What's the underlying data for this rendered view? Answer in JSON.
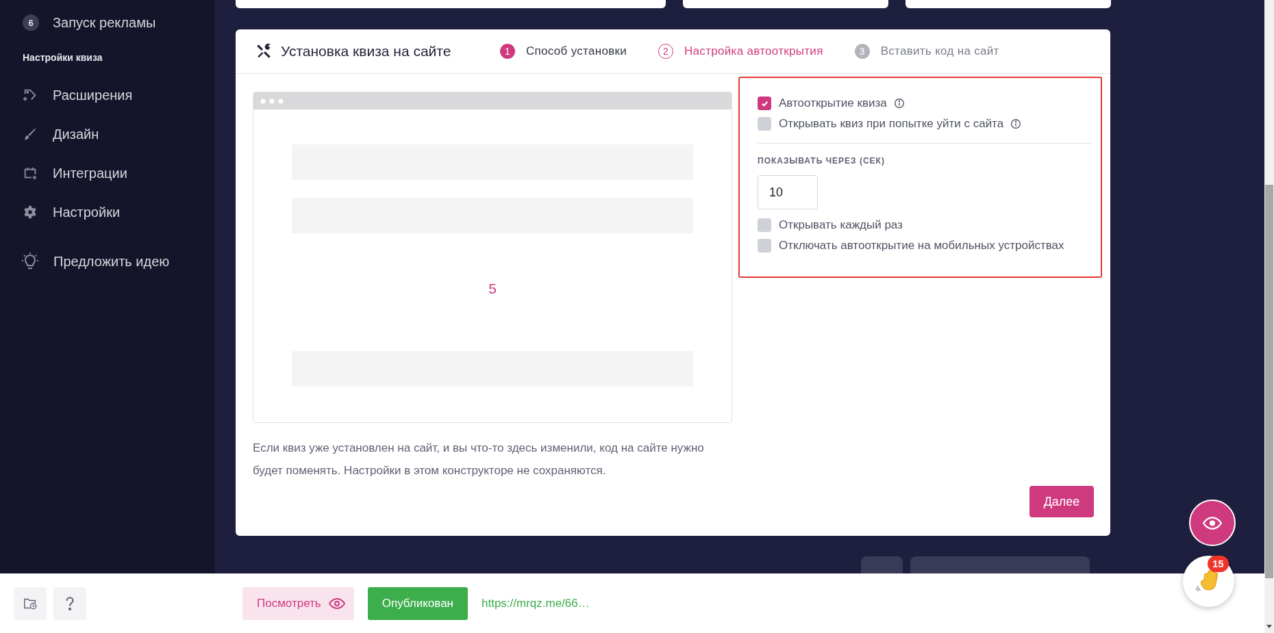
{
  "sidebar": {
    "step": {
      "number": "6",
      "label": "Запуск рекламы"
    },
    "section_title": "Настройки квиза",
    "items": [
      {
        "label": "Расширения"
      },
      {
        "label": "Дизайн"
      },
      {
        "label": "Интеграции"
      },
      {
        "label": "Настройки"
      }
    ],
    "suggest": {
      "label": "Предложить идею"
    }
  },
  "card": {
    "title": "Установка квиза на сайте",
    "steps": [
      {
        "number": "1",
        "label": "Способ установки",
        "done": true,
        "selected": false
      },
      {
        "number": "2",
        "label": "Настройка автооткрытия",
        "done": false,
        "selected": true
      },
      {
        "number": "3",
        "label": "Вставить код на сайт",
        "done": false,
        "selected": false
      }
    ],
    "preview": {
      "number": "5"
    },
    "note": "Если квиз уже установлен на сайт, и вы что-то здесь изменили, код на сайте нужно будет поменять. Настройки в этом конструкторе не сохраняются.",
    "settings": {
      "top": [
        {
          "label": "Автооткрытие квиза",
          "checked": true,
          "info": true
        },
        {
          "label": "Открывать квиз при попытке уйти с сайта",
          "checked": false,
          "info": true
        }
      ],
      "delay_label": "ПОКАЗЫВАТЬ ЧЕРЕЗ (СЕК)",
      "delay_value": "10",
      "bottom": [
        {
          "label": "Открывать каждый раз",
          "checked": false,
          "info": false
        },
        {
          "label": "Отключать автооткрытие на мобильных устройствах",
          "checked": false,
          "info": false
        }
      ]
    },
    "next_button": "Далее"
  },
  "bottom_bar": {
    "preview_button": "Посмотреть",
    "status_button": "Опубликован",
    "link": "https://mrqz.me/66…"
  },
  "chat": {
    "badge": "15"
  }
}
